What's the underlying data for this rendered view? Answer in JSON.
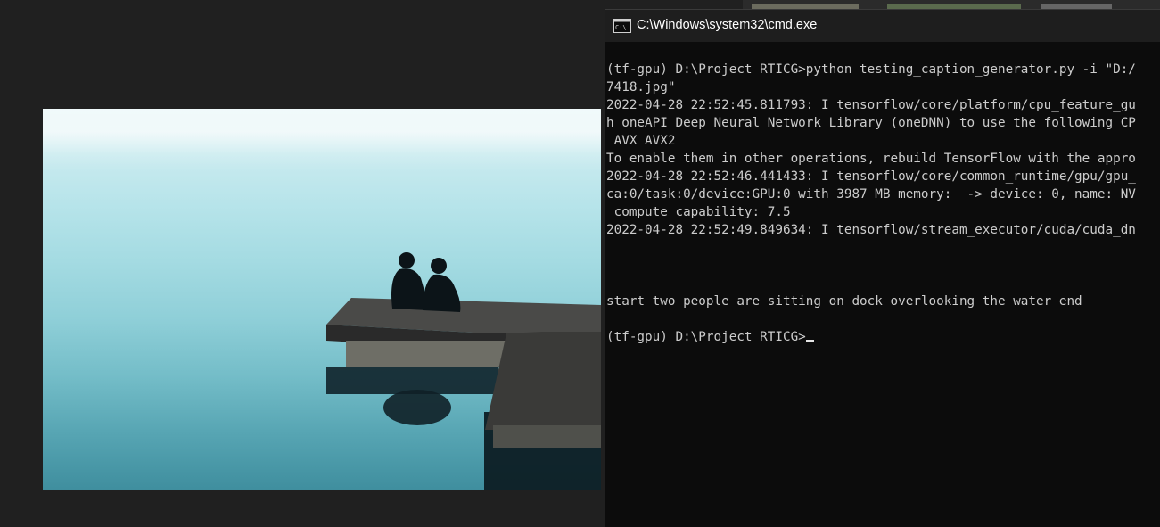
{
  "console": {
    "title": "C:\\Windows\\system32\\cmd.exe",
    "icon": "cmd-icon",
    "lines": [
      "(tf-gpu) D:\\Project RTICG>python testing_caption_generator.py -i \"D:/",
      "7418.jpg\"",
      "2022-04-28 22:52:45.811793: I tensorflow/core/platform/cpu_feature_gu",
      "h oneAPI Deep Neural Network Library (oneDNN) to use the following CP",
      " AVX AVX2",
      "To enable them in other operations, rebuild TensorFlow with the appro",
      "2022-04-28 22:52:46.441433: I tensorflow/core/common_runtime/gpu/gpu_",
      "ca:0/task:0/device:GPU:0 with 3987 MB memory:  -> device: 0, name: NV",
      " compute capability: 7.5",
      "2022-04-28 22:52:49.849634: I tensorflow/stream_executor/cuda/cuda_dn",
      "",
      "",
      "",
      "start two people are sitting on dock overlooking the water end",
      ""
    ],
    "prompt": "(tf-gpu) D:\\Project RTICG>"
  },
  "colors": {
    "console_bg": "#0c0c0c",
    "console_text": "#cccccc",
    "titlebar": "#1e1e1e",
    "desktop": "#202020"
  }
}
